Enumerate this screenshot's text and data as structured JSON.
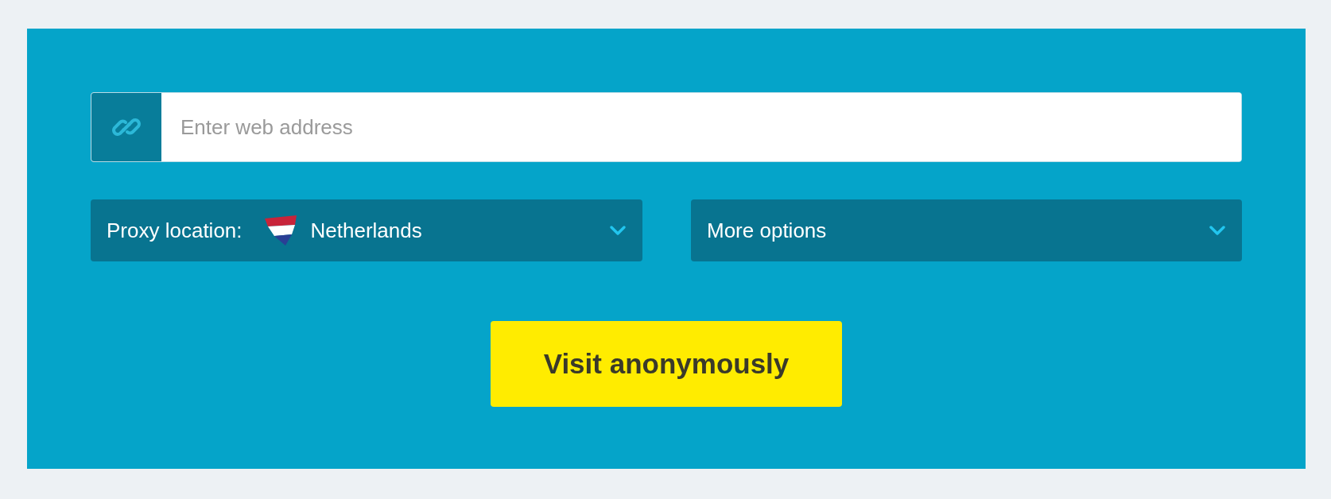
{
  "url_field": {
    "placeholder": "Enter web address"
  },
  "proxy_location": {
    "label": "Proxy location:",
    "value": "Netherlands"
  },
  "more_options": {
    "label": "More options"
  },
  "submit_button": {
    "label": "Visit anonymously"
  }
}
